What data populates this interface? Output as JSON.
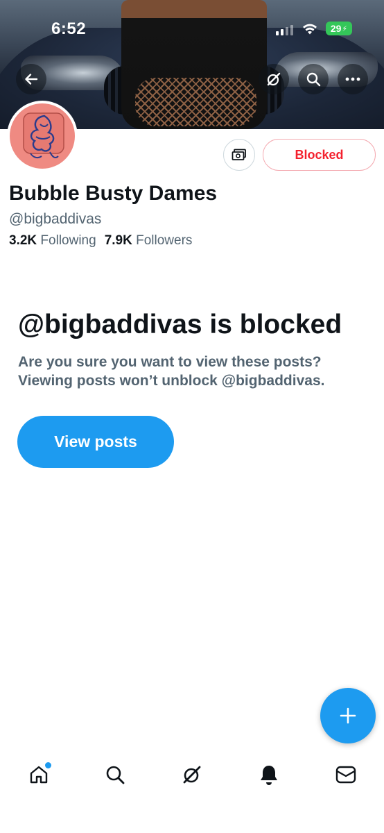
{
  "status_bar": {
    "time": "6:52",
    "battery": "29"
  },
  "profile": {
    "display_name": "Bubble Busty Dames",
    "handle": "@bigbaddivas",
    "following_count": "3.2K",
    "following_label": "Following",
    "followers_count": "7.9K",
    "followers_label": "Followers",
    "blocked_button": "Blocked"
  },
  "blocked_notice": {
    "title": "@bigbaddivas is blocked",
    "message": "Are you sure you want to view these posts? Viewing posts won’t unblock @bigbaddivas.",
    "view_button": "View posts"
  },
  "icons": {
    "back": "arrow-left-icon",
    "grok": "grok-icon",
    "search": "search-icon",
    "more": "more-icon",
    "subscribe": "money-icon",
    "compose": "plus-icon",
    "tabs": [
      "home-icon",
      "search-icon",
      "grok-icon",
      "bell-icon",
      "mail-icon"
    ]
  },
  "colors": {
    "accent": "#1d9bf0",
    "blocked_red": "#f4212e",
    "text_primary": "#0f1419",
    "text_secondary": "#536471",
    "battery_green": "#34c759",
    "avatar_bg": "#ef8a82"
  }
}
